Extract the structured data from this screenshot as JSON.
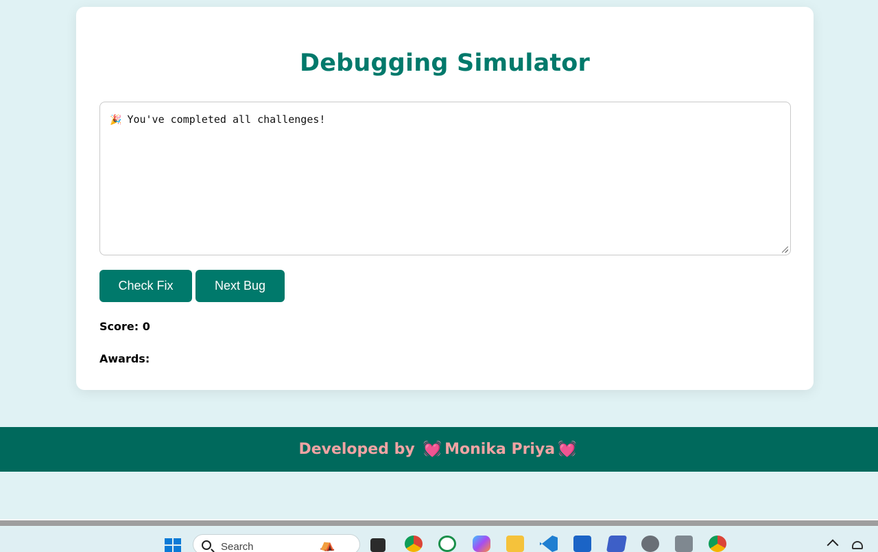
{
  "app": {
    "title": "Debugging Simulator",
    "editor_text": "You've completed all challenges!",
    "editor_emoji": "🎉"
  },
  "actions": {
    "check_label": "Check Fix",
    "next_label": "Next Bug"
  },
  "stats": {
    "score_text": "Score: 0",
    "awards_text": "Awards:"
  },
  "footer": {
    "prefix": "Developed by",
    "heart": "💓",
    "name": "Monika Priya"
  },
  "taskbar": {
    "search_placeholder": "Search",
    "icons": [
      "windows-start-icon",
      "search-icon",
      "task-view-icon",
      "chrome-icon",
      "whatsapp-icon",
      "copilot-icon",
      "file-explorer-icon",
      "vscode-icon",
      "store-icon",
      "powershell-icon",
      "settings-icon",
      "camera-icon",
      "chrome-profile-icon",
      "chevron-up-icon",
      "network-icon"
    ]
  },
  "colors": {
    "accent": "#00796b",
    "footer_bg": "#00695c",
    "footer_text": "#f0a3a3",
    "page_bg": "#e0f2f4"
  }
}
